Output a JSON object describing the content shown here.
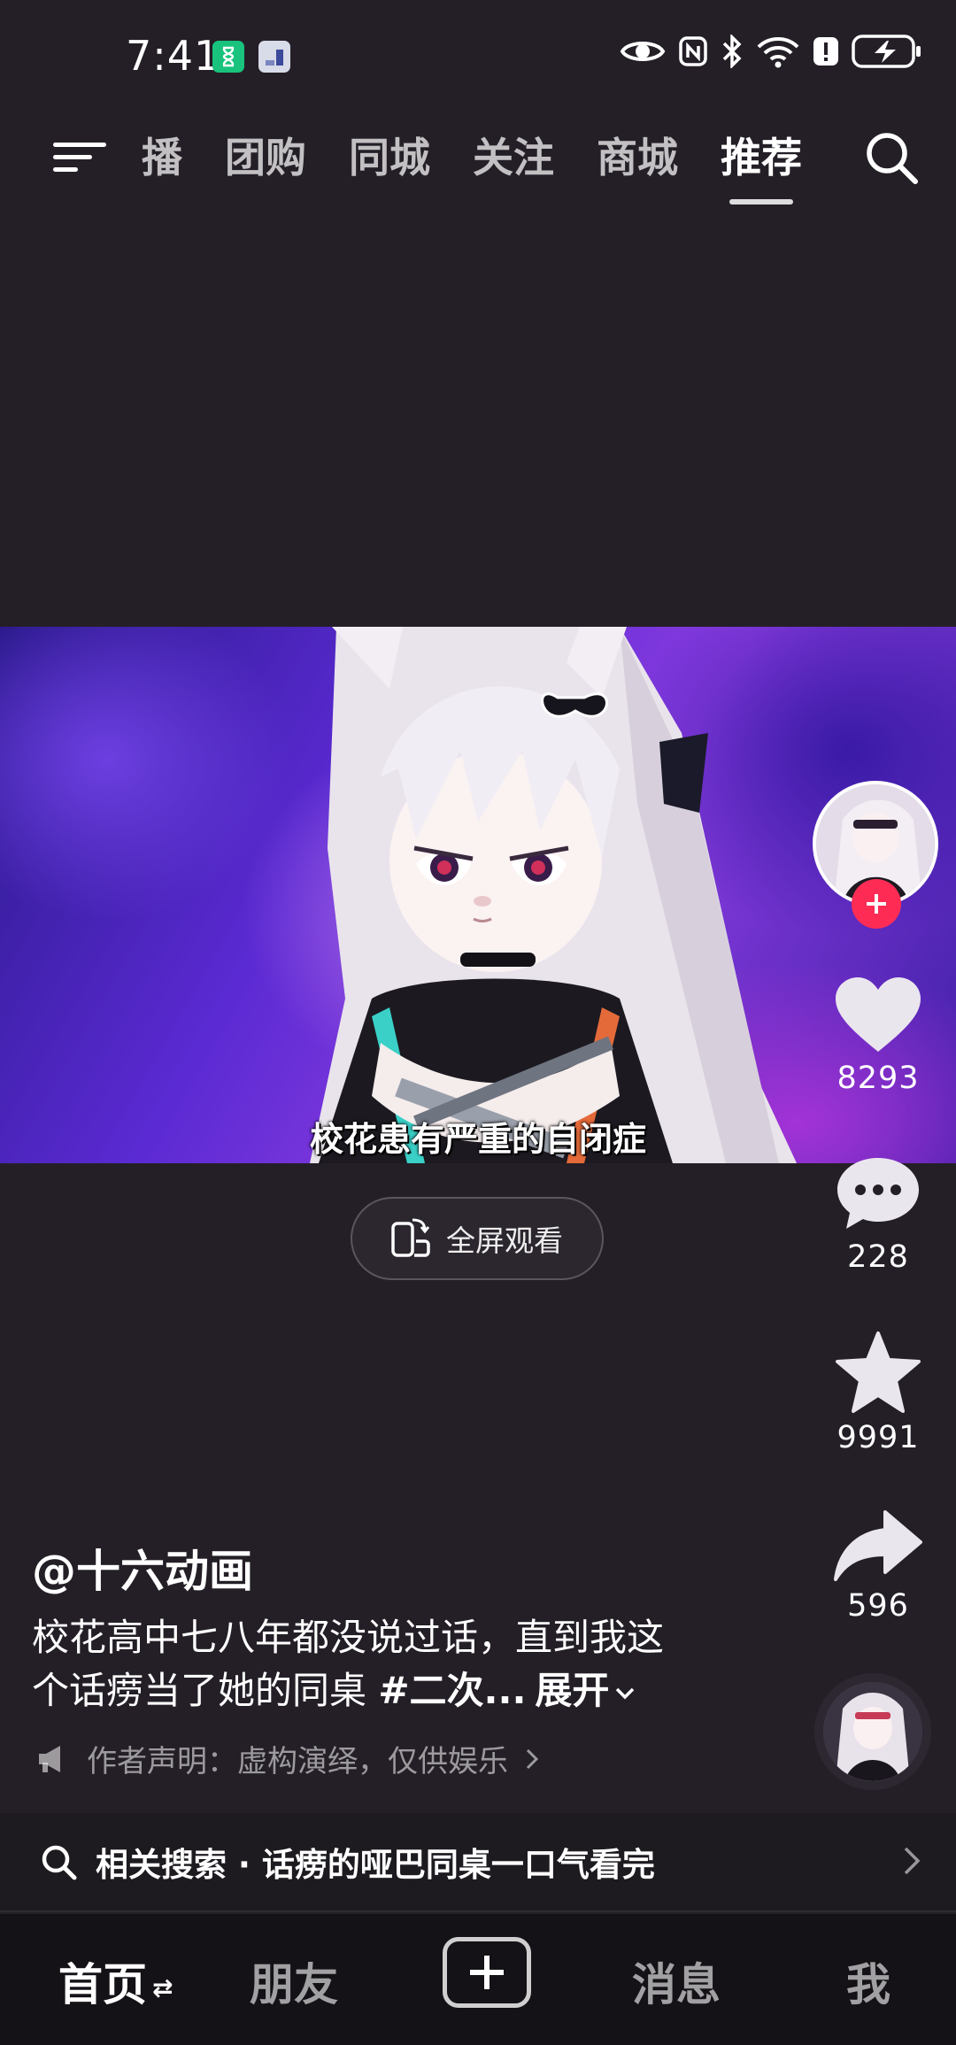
{
  "status_bar": {
    "time": "7:41",
    "icons": [
      "hourglass-app-icon",
      "storage-app-icon",
      "eye-icon",
      "nfc-icon",
      "bluetooth-icon",
      "wifi-icon",
      "alert-icon",
      "battery-charging-icon"
    ]
  },
  "top_nav": {
    "tabs": [
      {
        "label": "播"
      },
      {
        "label": "团购"
      },
      {
        "label": "同城"
      },
      {
        "label": "关注"
      },
      {
        "label": "商城"
      },
      {
        "label": "推荐"
      }
    ],
    "active_tab": "推荐"
  },
  "video": {
    "caption": "校花患有严重的自闭症"
  },
  "fullscreen": {
    "label": "全屏观看"
  },
  "rail": {
    "likes": "8293",
    "comments": "228",
    "favorites": "9991",
    "shares": "596"
  },
  "post": {
    "author": "@十六动画",
    "description_line1": "校花高中七八年都没说过话，直到我这",
    "description_line2": "个话痨当了她的同桌 ",
    "hashtag": "#二次...",
    "expand": "展开",
    "statement": "作者声明：虚构演绎，仅供娱乐"
  },
  "related_search": {
    "text": "相关搜索 · 话痨的哑巴同桌一口气看完"
  },
  "bottom_nav": {
    "home": "首页",
    "home_suffix": "⇄",
    "friends": "朋友",
    "messages": "消息",
    "me": "我"
  },
  "colors": {
    "background": "#241f27",
    "follow_red": "#fe2c55",
    "bottom_nav_bg": "#151217"
  }
}
